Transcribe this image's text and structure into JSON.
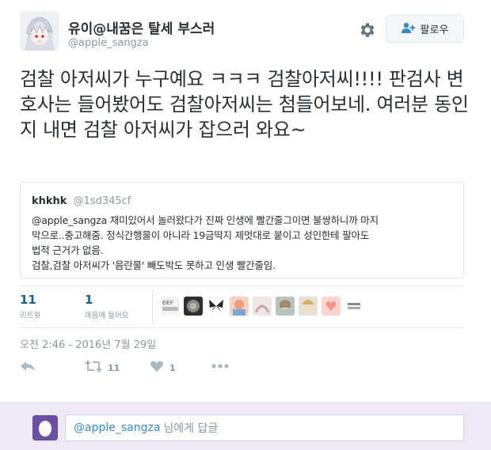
{
  "header": {
    "display_name": "유이@내꿈은 탈세 부스러",
    "handle": "@apple_sangza",
    "gear_icon": "gear-icon",
    "follow_label": "팔로우",
    "follow_icon": "person-plus-icon"
  },
  "tweet": {
    "text": "검찰 아저씨가 누구예요 ㅋㅋㅋ 검찰아저씨!!!! 판검사 변호사는 들어봤어도 검찰아저씨는 첨들어보네. 여러분 동인지 내면 검찰 아저씨가 잡으러 와요~"
  },
  "quoted": {
    "name": "khkhk",
    "handle": "@1sd345cf",
    "lines": [
      "@apple_sangza 재미있어서 놀러왔다가 진짜 인생에 빨간줄그이면 불쌍하니까 마지",
      "막으로..충고해줌. 정식간행물이 아니라 19금딱지 제멋대로 붙이고 성인한테 팔아도",
      "법적 근거가 없음.",
      "검찰,검찰 아저씨가 '음란물' 빼도박도 못하고 인생 빨간줄임."
    ]
  },
  "stats": {
    "retweets": {
      "count": "11",
      "label": "리트윗"
    },
    "likes": {
      "count": "1",
      "label": "마음에 들어요"
    }
  },
  "likers": [
    "liker-1",
    "liker-2",
    "liker-3",
    "liker-4",
    "liker-5",
    "liker-6",
    "liker-7",
    "liker-8",
    "liker-9"
  ],
  "timestamp": "오전 2:46 - 2016년 7월 29일",
  "actions": {
    "reply_icon": "reply-icon",
    "retweet_icon": "retweet-icon",
    "retweet_count": "11",
    "like_icon": "heart-icon",
    "like_count": "1",
    "more_icon": "more-icon"
  },
  "reply": {
    "mention": "@apple_sangza",
    "placeholder_rest": "님에게 답글"
  },
  "colors": {
    "link": "#1d5f8a",
    "muted": "#8899a6",
    "reply_bar_bg": "#eeeaf5"
  }
}
